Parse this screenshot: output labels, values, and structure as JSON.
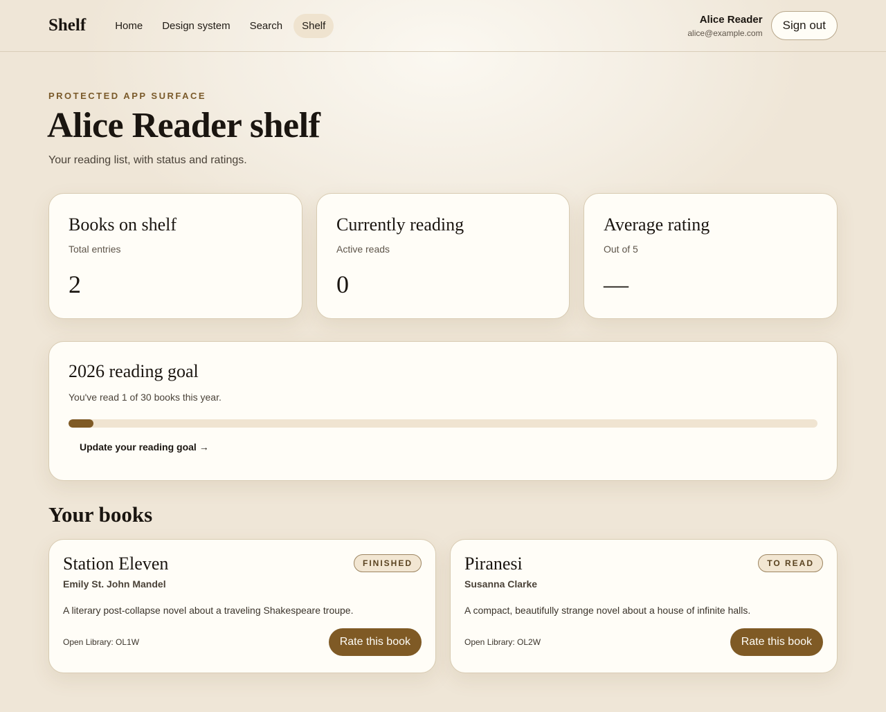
{
  "header": {
    "brand": "Shelf",
    "nav": [
      {
        "label": "Home"
      },
      {
        "label": "Design system"
      },
      {
        "label": "Search"
      },
      {
        "label": "Shelf"
      }
    ],
    "user_name": "Alice Reader",
    "user_email": "alice@example.com",
    "signout_label": "Sign out"
  },
  "hero": {
    "eyebrow": "PROTECTED APP SURFACE",
    "title": "Alice Reader shelf",
    "subtitle": "Your reading list, with status and ratings."
  },
  "stats": [
    {
      "title": "Books on shelf",
      "sub": "Total entries",
      "value": "2"
    },
    {
      "title": "Currently reading",
      "sub": "Active reads",
      "value": "0"
    },
    {
      "title": "Average rating",
      "sub": "Out of 5",
      "value": "—"
    }
  ],
  "goal": {
    "title": "2026 reading goal",
    "text": "You've read 1 of 30 books this year.",
    "progress": 0.0333,
    "link_label": "Update your reading goal →"
  },
  "books_section": {
    "title": "Your books"
  },
  "books": [
    {
      "title": "Station Eleven",
      "status": "FINISHED",
      "author": "Emily St. John Mandel",
      "description": "A literary post-collapse novel about a traveling Shakespeare troupe.",
      "open_library": "Open Library: OL1W",
      "rate_label": "Rate this book"
    },
    {
      "title": "Piranesi",
      "status": "TO READ",
      "author": "Susanna Clarke",
      "description": "A compact, beautifully strange novel about a house of infinite halls.",
      "open_library": "Open Library: OL2W",
      "rate_label": "Rate this book"
    }
  ],
  "colors": {
    "accent": "#7f5a25",
    "badge_bg": "#f2e6d2",
    "card_bg": "#fffdf7",
    "page_bg": "#f1e9dc"
  }
}
